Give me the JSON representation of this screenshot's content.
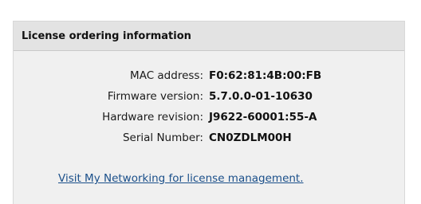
{
  "panel": {
    "title": "License ordering information"
  },
  "info": {
    "rows": [
      {
        "label": "MAC address:",
        "value": "F0:62:81:4B:00:FB"
      },
      {
        "label": "Firmware version:",
        "value": "5.7.0.0-01-10630"
      },
      {
        "label": "Hardware revision:",
        "value": "J9622-60001:55-A"
      },
      {
        "label": "Serial Number:",
        "value": "CN0ZDLM00H"
      }
    ]
  },
  "link": {
    "text": "Visit My Networking for license management."
  },
  "colors": {
    "link": "#1a4f8a",
    "header_bg": "#e3e3e3",
    "panel_bg": "#f0f0f0"
  }
}
